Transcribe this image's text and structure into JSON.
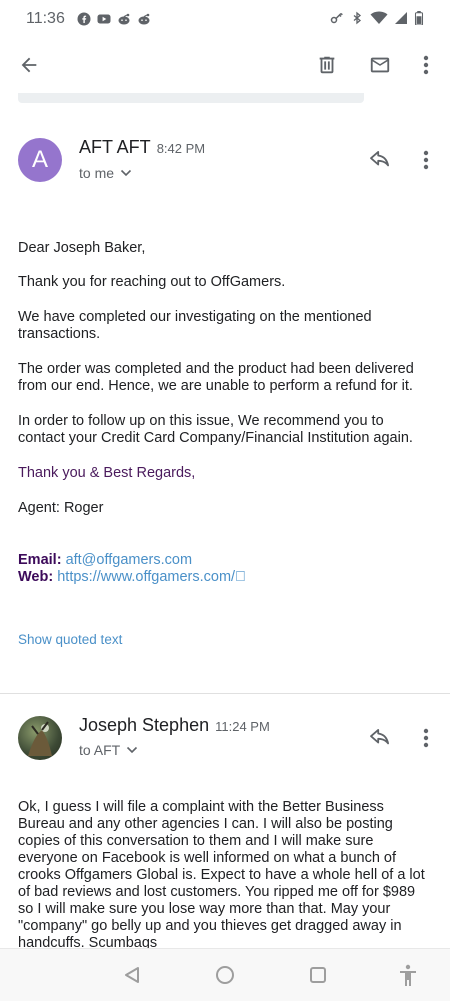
{
  "status": {
    "time": "11:36",
    "left_icons": [
      "facebook-icon",
      "youtube-icon",
      "reddit-icon",
      "reddit-icon"
    ],
    "right_icons": [
      "vpn-key-icon",
      "bluetooth-icon",
      "wifi-icon",
      "signal-icon",
      "battery-icon"
    ]
  },
  "toolbar": {
    "back": "arrow-back-icon",
    "delete": "trash-icon",
    "mark_unread": "mail-icon",
    "more": "more-vert-icon"
  },
  "message1": {
    "avatar_letter": "A",
    "avatar_color": "#9575cd",
    "sender": "AFT AFT",
    "time": "8:42 PM",
    "recipient": "to me",
    "body": {
      "greeting": "Dear Joseph Baker,",
      "para1": "Thank you for reaching out to OffGamers.",
      "para2": "We have completed our investigating on the mentioned transactions.",
      "para3": "The order was completed and the product had been delivered from our end. Hence, we are unable to perform a refund for it.",
      "para4": "In order to follow up on this issue, We recommend you to contact your Credit Card Company/Financial Institution again.",
      "regards": "Thank you & Best Regards,",
      "agent": "Agent: Roger",
      "email_label": "Email",
      "email_value": "aft@offgamers.com",
      "web_label": "Web",
      "web_value": "https://www.offgamers.com/"
    },
    "show_quoted": "Show quoted text"
  },
  "message2": {
    "sender": "Joseph Stephen",
    "time": "11:24 PM",
    "recipient": "to AFT",
    "body": "Ok, I guess I will file a complaint with the Better Business Bureau and any other agencies I can. I will also be posting copies of this conversation to them and I will make sure everyone on Facebook is well informed on what a bunch of crooks Offgamers Global is. Expect to have a whole hell of a lot of bad reviews and lost customers. You ripped me off for $989 so I will make sure you lose way more than that. May your \"company\" go belly up and you thieves get dragged away in handcuffs. Scumbags"
  },
  "nav": {
    "back": "nav-back-icon",
    "home": "nav-home-icon",
    "recents": "nav-recents-icon",
    "accessibility": "accessibility-icon"
  },
  "colors": {
    "purple_text": "#4a1a5c",
    "link": "#4a90c8",
    "icon_gray": "#5f6368"
  }
}
